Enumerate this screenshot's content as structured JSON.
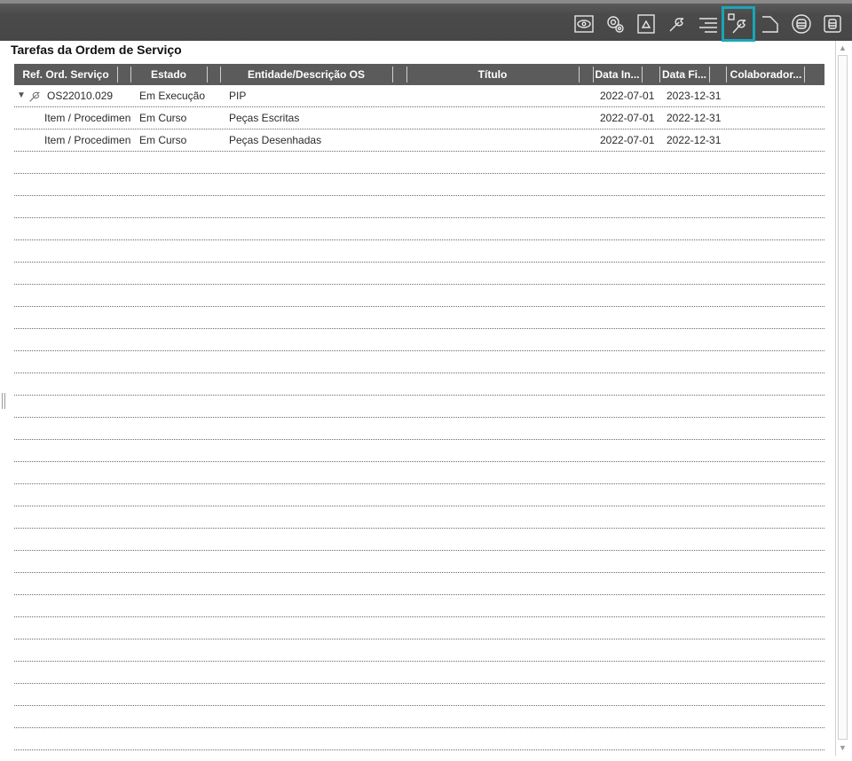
{
  "toolbar": {
    "buttons": [
      {
        "name": "eye-icon"
      },
      {
        "name": "gears-icon"
      },
      {
        "name": "triangle-doc-icon"
      },
      {
        "name": "wrench-icon"
      },
      {
        "name": "list-lines-icon"
      },
      {
        "name": "maintenance-wrench-icon",
        "active": true
      },
      {
        "name": "return-doc-icon"
      },
      {
        "name": "database-circle-icon"
      },
      {
        "name": "database-box-icon"
      }
    ],
    "active_color": "#1aa5b8"
  },
  "panel": {
    "title": "Tarefas da Ordem de Serviço"
  },
  "table": {
    "columns": [
      "Ref. Ord. Serviço",
      "Estado",
      "Entidade/Descrição OS",
      "",
      "Título",
      "Data In...",
      "Data Fi...",
      "Colaborador..."
    ],
    "rows": [
      {
        "ref": "OS22010.029",
        "estado": "Em Execução",
        "entidade": "PIP",
        "titulo": "",
        "data_inicio": "2022-07-01",
        "data_fim": "2023-12-31",
        "colaborador": "",
        "expanded": true,
        "icon": "wrench-icon"
      },
      {
        "ref": "Item / Procedimen",
        "estado": "Em Curso",
        "entidade": "Peças Escritas",
        "titulo": "",
        "data_inicio": "2022-07-01",
        "data_fim": "2022-12-31",
        "colaborador": ""
      },
      {
        "ref": "Item / Procedimen",
        "estado": "Em Curso",
        "entidade": "Peças Desenhadas",
        "titulo": "",
        "data_inicio": "2022-07-01",
        "data_fim": "2022-12-31",
        "colaborador": ""
      }
    ]
  }
}
